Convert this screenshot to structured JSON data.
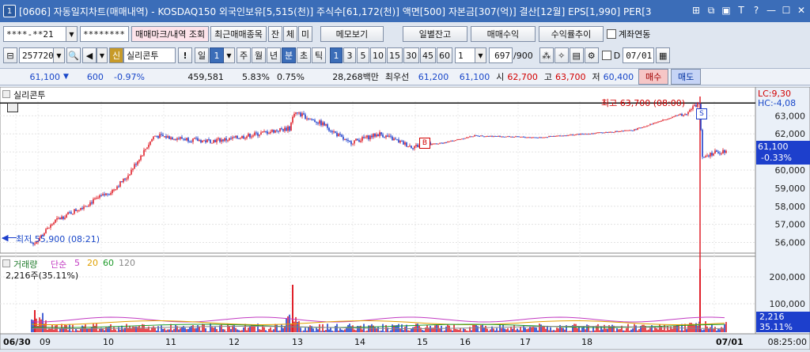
{
  "window": {
    "icon_label": "1",
    "title": "[0606] 자동일지차트(매매내역) - KOSDAQ150 외국인보유[5,515(천)] 주식수[61,172(천)] 액면[500] 자본금[307(억)] 결산[12월] EPS[1,990] PER[3"
  },
  "toolbar1": {
    "account": "****-**21",
    "password": "********",
    "btn_trade_mark": "매매마크/내역 조회",
    "btn_recent": "최근매매종목",
    "btn_jan": "잔",
    "btn_che": "체",
    "btn_mi": "미",
    "btn_memo": "메모보기",
    "btn_daily_balance": "일별잔고",
    "btn_trade_profit": "매매수익",
    "btn_return_trend": "수익률추이",
    "account_link_label": "계좌연동"
  },
  "toolbar2": {
    "code": "257720",
    "badge": "신",
    "name": "실리콘투",
    "alert": "!",
    "period_day": "일",
    "period_num": "1",
    "week": "주",
    "month": "월",
    "year": "년",
    "minute": "분",
    "second": "초",
    "tick": "틱",
    "intervals": [
      "1",
      "3",
      "5",
      "10",
      "15",
      "30",
      "45",
      "60"
    ],
    "interval_input": "1",
    "count": "697",
    "count_total": "/900",
    "d_label": "D",
    "date": "07/01"
  },
  "quote": {
    "price": "61,100",
    "change": "600",
    "change_pct": "-0.97%",
    "volume": "459,581",
    "turnover_pct": "5.83%",
    "ratio": "0.75%",
    "amount": "28,268백만",
    "best_ask_label": "최우선",
    "best_ask": "61,200",
    "best_bid": "61,100",
    "open_label": "시",
    "open": "62,700",
    "high_label": "고",
    "high": "63,700",
    "low_label": "저",
    "low": "60,400",
    "buy_btn": "매수",
    "sell_btn": "매도"
  },
  "price_pane": {
    "title": "실리콘투",
    "lc": "LC:9,30",
    "hc": "HC:-4,08",
    "high_annotation": "최고 63,700 (08:00)",
    "low_annotation": "최저 55,900 (08:21)",
    "last_price": "61,100",
    "last_pct": "-0.33%",
    "buy_marker": "B",
    "sell_marker": "S"
  },
  "volume_pane": {
    "title_volume": "거래량",
    "title_simple": "단순",
    "ma_periods": [
      "5",
      "20",
      "60",
      "120"
    ],
    "subtitle": "2,216주(35.11%)",
    "last_volume": "2,216",
    "last_pct": "35.11%"
  },
  "time_axis": {
    "labels": [
      "06/30",
      "09",
      "10",
      "11",
      "12",
      "13",
      "14",
      "15",
      "16",
      "17",
      "18",
      "07/01"
    ],
    "current_time": "08:25:00"
  },
  "chart_data": {
    "type": "candlestick",
    "y_axis_price": {
      "ticks": [
        "63,000",
        "62,000",
        "61,000",
        "60,000",
        "59,000",
        "58,000",
        "57,000",
        "56,000"
      ],
      "range": [
        55500,
        63800
      ]
    },
    "y_axis_volume": {
      "ticks": [
        "200,000",
        "100,000"
      ]
    },
    "price_path": [
      [
        "06/30 08:00",
        56000
      ],
      [
        "06/30 08:21",
        55900
      ],
      [
        "06/30 09:00",
        57200
      ],
      [
        "06/30 10:00",
        58800
      ],
      [
        "06/30 10:30",
        59600
      ],
      [
        "06/30 11:00",
        61900
      ],
      [
        "06/30 11:30",
        61600
      ],
      [
        "06/30 12:00",
        61700
      ],
      [
        "06/30 12:30",
        62200
      ],
      [
        "06/30 13:00",
        62300
      ],
      [
        "06/30 13:10",
        63200
      ],
      [
        "06/30 13:40",
        62500
      ],
      [
        "06/30 14:00",
        61500
      ],
      [
        "06/30 14:30",
        62000
      ],
      [
        "06/30 15:00",
        61300
      ],
      [
        "06/30 15:30",
        61500
      ],
      [
        "06/30 16:00",
        61900
      ],
      [
        "06/30 17:00",
        61800
      ],
      [
        "06/30 18:00",
        62000
      ],
      [
        "06/30 19:00",
        62200
      ],
      [
        "06/30 19:50",
        63200
      ],
      [
        "07/01 08:00",
        63700
      ],
      [
        "07/01 08:05",
        60800
      ],
      [
        "07/01 08:25",
        61100
      ]
    ],
    "trades": [
      {
        "side": "B",
        "time": "06/30 15:15",
        "price": 61000
      },
      {
        "side": "S",
        "time": "07/01 08:00",
        "price": 63500
      }
    ]
  },
  "colors": {
    "up": "#e0202a",
    "down": "#1d3fcc",
    "title_bar": "#3b6db8",
    "ma5": "#c23bc2",
    "ma20": "#e0a000",
    "ma60": "#1e9a2a",
    "ma120": "#888888"
  }
}
